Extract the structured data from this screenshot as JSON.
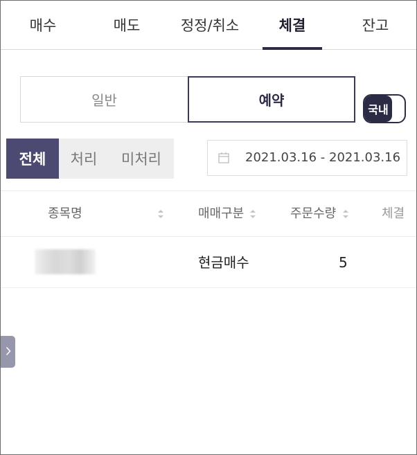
{
  "tabs": [
    {
      "label": "매수"
    },
    {
      "label": "매도"
    },
    {
      "label": "정정/취소"
    },
    {
      "label": "체결"
    },
    {
      "label": "잔고"
    }
  ],
  "active_tab": "체결",
  "segments": {
    "normal": "일반",
    "reserve": "예약",
    "selected": "예약"
  },
  "toggle": {
    "label": "국내"
  },
  "filters": {
    "all": "전체",
    "done": "처리",
    "undone": "미처리",
    "selected": "전체"
  },
  "date_range": {
    "text": "2021.03.16 - 2021.03.16",
    "icon": "calendar-icon"
  },
  "table": {
    "columns": [
      "종목명",
      "매매구분",
      "주문수량",
      "체결"
    ],
    "rows": [
      {
        "name": "",
        "type": "현금매수",
        "qty": "5"
      }
    ]
  },
  "colors": {
    "accent": "#2b2b45",
    "filter_active": "#4c4a72",
    "side_handle": "#9696ad"
  }
}
